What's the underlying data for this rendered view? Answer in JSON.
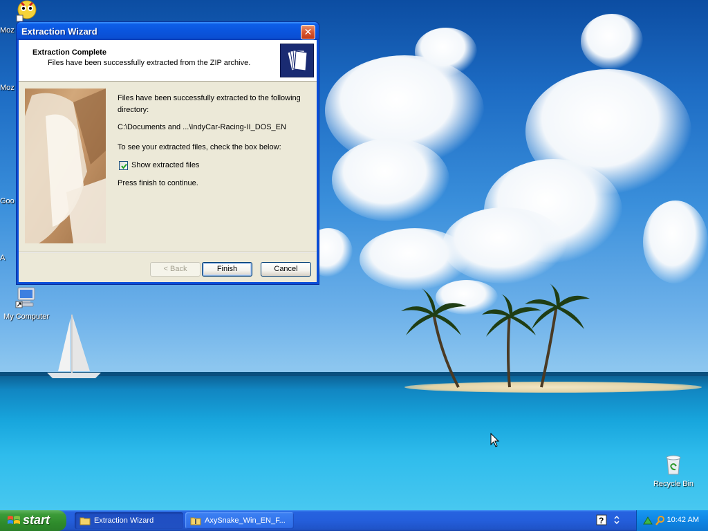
{
  "desktop": {
    "icons": {
      "my_computer": "My Computer",
      "recycle_bin": "Recycle Bin"
    },
    "edge_labels": [
      "Moz",
      "Moz",
      "Goo",
      "A"
    ]
  },
  "window": {
    "title": "Extraction Wizard",
    "close_glyph": "✕",
    "header": {
      "title": "Extraction Complete",
      "subtitle": "Files have been successfully extracted from the ZIP archive."
    },
    "body": {
      "line1": "Files have been successfully extracted to the following",
      "line2": "directory:",
      "path": "C:\\Documents and ...\\IndyCar-Racing-II_DOS_EN",
      "instruction": "To see your extracted files, check the box below:",
      "checkbox_label": "Show extracted files",
      "checkbox_checked": true,
      "continue_text": "Press finish to continue."
    },
    "buttons": {
      "back": "< Back",
      "finish": "Finish",
      "cancel": "Cancel"
    }
  },
  "taskbar": {
    "start_label": "start",
    "tasks": [
      {
        "label": "Extraction Wizard",
        "active": true
      },
      {
        "label": "AxySnake_Win_EN_F...",
        "active": false
      }
    ],
    "clock": "10:42 AM"
  },
  "colors": {
    "titlebar": "#0a55de",
    "taskbar": "#245edb",
    "start": "#3c9b39",
    "dialog_face": "#ece9d8"
  }
}
